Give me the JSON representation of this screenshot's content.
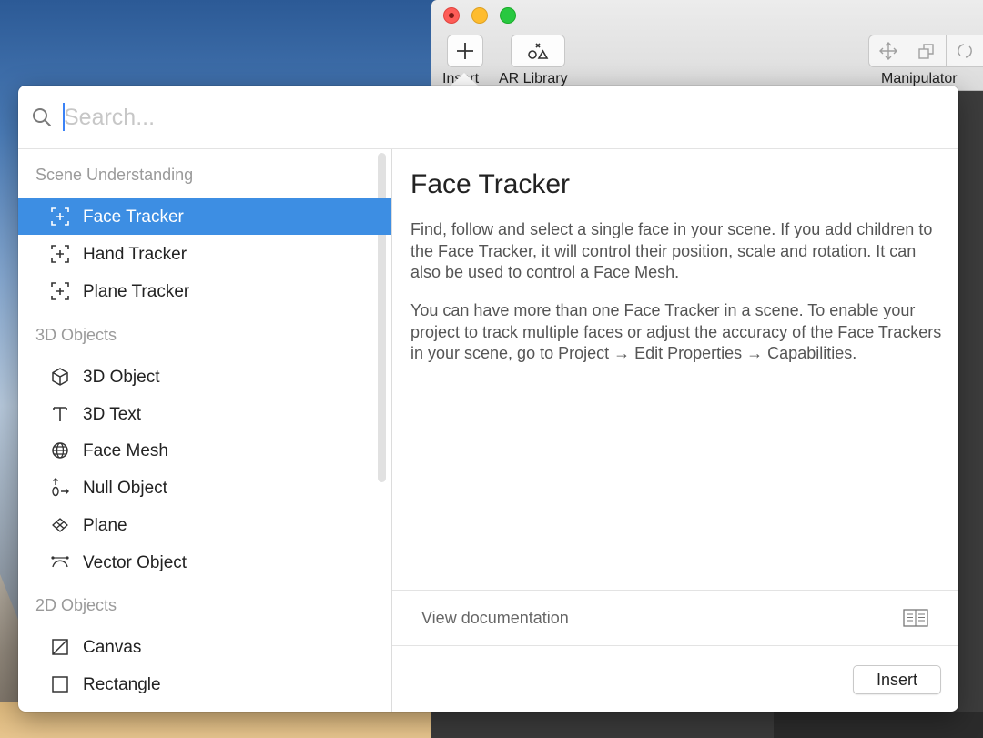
{
  "app": {
    "toolbar": {
      "insert_label": "Insert",
      "ar_library_label": "AR Library",
      "manipulator_label": "Manipulator"
    }
  },
  "search": {
    "placeholder": "Search...",
    "value": ""
  },
  "sidebar": {
    "groups": [
      {
        "header": "Scene Understanding",
        "items": [
          {
            "label": "Face Tracker",
            "icon": "tracker-icon",
            "selected": true
          },
          {
            "label": "Hand Tracker",
            "icon": "tracker-icon",
            "selected": false
          },
          {
            "label": "Plane Tracker",
            "icon": "tracker-icon",
            "selected": false
          }
        ]
      },
      {
        "header": "3D Objects",
        "items": [
          {
            "label": "3D Object",
            "icon": "cube-icon"
          },
          {
            "label": "3D Text",
            "icon": "text-icon"
          },
          {
            "label": "Face Mesh",
            "icon": "globe-icon"
          },
          {
            "label": "Null Object",
            "icon": "null-object-icon"
          },
          {
            "label": "Plane",
            "icon": "plane-icon"
          },
          {
            "label": "Vector Object",
            "icon": "vector-icon"
          }
        ]
      },
      {
        "header": "2D Objects",
        "items": [
          {
            "label": "Canvas",
            "icon": "canvas-icon"
          },
          {
            "label": "Rectangle",
            "icon": "rectangle-icon"
          }
        ]
      }
    ]
  },
  "detail": {
    "title": "Face Tracker",
    "paragraph1": "Find, follow and select a single face in your scene. If you add children to the Face Tracker, it will control their position, scale and rotation. It can also be used to control a Face Mesh.",
    "paragraph2": "You can have more than one Face Tracker in a scene. To enable your project to track multiple faces or adjust the accuracy of the Face Trackers in your scene, go to Project → Edit Properties → Capabilities.",
    "documentation_label": "View documentation",
    "insert_button": "Insert"
  },
  "colors": {
    "selection": "#3d8ee3",
    "caret": "#3b82f6"
  }
}
